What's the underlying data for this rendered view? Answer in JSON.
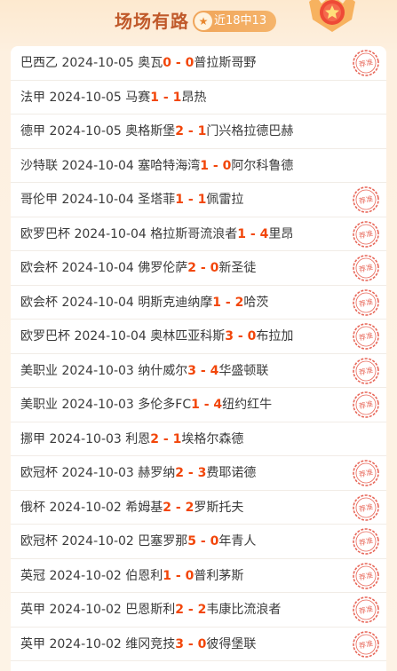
{
  "header": {
    "title": "场场有路",
    "record_label": "近18中13",
    "star_glyph": "★"
  },
  "stamp_text": "荐准",
  "matches": [
    {
      "league": "巴西乙",
      "date": "2024-10-05",
      "home": "奥瓦",
      "home_score": "0",
      "away_score": "0",
      "away": "普拉斯哥野",
      "stamp": true
    },
    {
      "league": "法甲",
      "date": "2024-10-05",
      "home": "马赛",
      "home_score": "1",
      "away_score": "1",
      "away": "昂热",
      "stamp": false
    },
    {
      "league": "德甲",
      "date": "2024-10-05",
      "home": "奥格斯堡",
      "home_score": "2",
      "away_score": "1",
      "away": "门兴格拉德巴赫",
      "stamp": false
    },
    {
      "league": "沙特联",
      "date": "2024-10-04",
      "home": "塞哈特海湾",
      "home_score": "1",
      "away_score": "0",
      "away": "阿尔科鲁德",
      "stamp": false
    },
    {
      "league": "哥伦甲",
      "date": "2024-10-04",
      "home": "圣塔菲",
      "home_score": "1",
      "away_score": "1",
      "away": "佩雷拉",
      "stamp": true
    },
    {
      "league": "欧罗巴杯",
      "date": "2024-10-04",
      "home": "格拉斯哥流浪者",
      "home_score": "1",
      "away_score": "4",
      "away": "里昂",
      "stamp": true
    },
    {
      "league": "欧会杯",
      "date": "2024-10-04",
      "home": "佛罗伦萨",
      "home_score": "2",
      "away_score": "0",
      "away": "新圣徒",
      "stamp": true
    },
    {
      "league": "欧会杯",
      "date": "2024-10-04",
      "home": "明斯克迪纳摩",
      "home_score": "1",
      "away_score": "2",
      "away": "哈茨",
      "stamp": true
    },
    {
      "league": "欧罗巴杯",
      "date": "2024-10-04",
      "home": "奥林匹亚科斯",
      "home_score": "3",
      "away_score": "0",
      "away": "布拉加",
      "stamp": true
    },
    {
      "league": "美职业",
      "date": "2024-10-03",
      "home": "纳什威尔",
      "home_score": "3",
      "away_score": "4",
      "away": "华盛顿联",
      "stamp": true
    },
    {
      "league": "美职业",
      "date": "2024-10-03",
      "home": "多伦多FC",
      "home_score": "1",
      "away_score": "4",
      "away": "纽约红牛",
      "stamp": true
    },
    {
      "league": "挪甲",
      "date": "2024-10-03",
      "home": "利恩",
      "home_score": "2",
      "away_score": "1",
      "away": "埃格尔森德",
      "stamp": false
    },
    {
      "league": "欧冠杯",
      "date": "2024-10-03",
      "home": "赫罗纳",
      "home_score": "2",
      "away_score": "3",
      "away": "费耶诺德",
      "stamp": true
    },
    {
      "league": "俄杯",
      "date": "2024-10-02",
      "home": "希姆基",
      "home_score": "2",
      "away_score": "2",
      "away": "罗斯托夫",
      "stamp": true
    },
    {
      "league": "欧冠杯",
      "date": "2024-10-02",
      "home": "巴塞罗那",
      "home_score": "5",
      "away_score": "0",
      "away": "年青人",
      "stamp": true
    },
    {
      "league": "英冠",
      "date": "2024-10-02",
      "home": "伯恩利",
      "home_score": "1",
      "away_score": "0",
      "away": "普利茅斯",
      "stamp": true
    },
    {
      "league": "英甲",
      "date": "2024-10-02",
      "home": "巴恩斯利",
      "home_score": "2",
      "away_score": "2",
      "away": "韦康比流浪者",
      "stamp": true
    },
    {
      "league": "英甲",
      "date": "2024-10-02",
      "home": "维冈竞技",
      "home_score": "3",
      "away_score": "0",
      "away": "彼得堡联",
      "stamp": true
    }
  ]
}
